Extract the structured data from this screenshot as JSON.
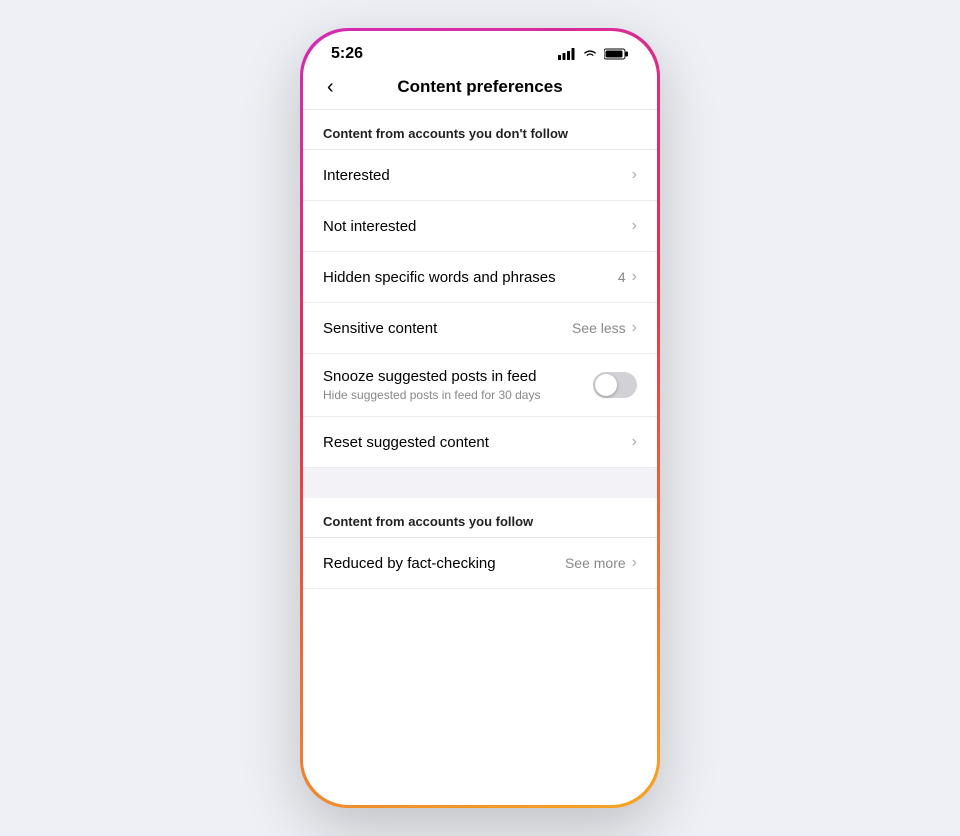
{
  "statusBar": {
    "time": "5:26"
  },
  "header": {
    "title": "Content preferences",
    "backLabel": "‹"
  },
  "sections": [
    {
      "id": "not-following",
      "label": "Content from accounts you don't follow",
      "items": [
        {
          "id": "interested",
          "label": "Interested",
          "badge": "",
          "type": "chevron",
          "sublabel": ""
        },
        {
          "id": "not-interested",
          "label": "Not interested",
          "badge": "",
          "type": "chevron",
          "sublabel": ""
        },
        {
          "id": "hidden-words",
          "label": "Hidden specific words and phrases",
          "badge": "4",
          "type": "chevron",
          "sublabel": ""
        },
        {
          "id": "sensitive-content",
          "label": "Sensitive content",
          "badge": "See less",
          "type": "chevron",
          "sublabel": ""
        },
        {
          "id": "snooze",
          "label": "Snooze suggested posts in feed",
          "sublabel": "Hide suggested posts in feed for 30 days",
          "type": "toggle",
          "toggleOn": false
        },
        {
          "id": "reset",
          "label": "Reset suggested content",
          "badge": "",
          "type": "chevron",
          "sublabel": ""
        }
      ]
    },
    {
      "id": "following",
      "label": "Content from accounts you follow",
      "items": [
        {
          "id": "fact-checking",
          "label": "Reduced by fact-checking",
          "badge": "See more",
          "type": "chevron",
          "sublabel": ""
        }
      ]
    }
  ]
}
